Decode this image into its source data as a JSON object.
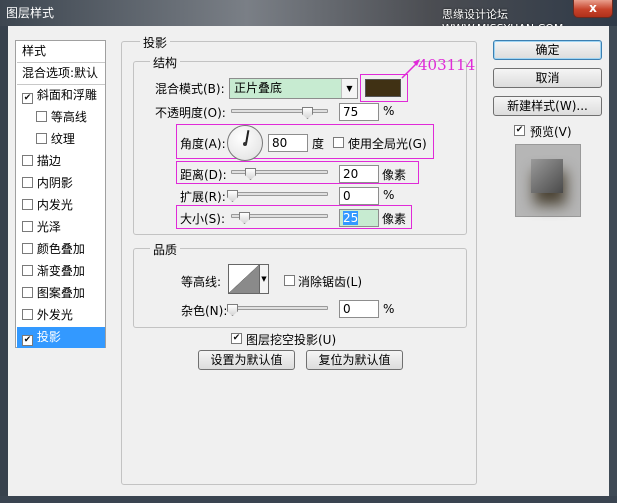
{
  "window": {
    "title": "图层样式",
    "watermark": "思缘设计论坛  WWW.MISSYUAN.COM",
    "close_label": "x"
  },
  "left_panel": {
    "items": [
      {
        "label": "样式",
        "checkbox": false,
        "checked": false,
        "selected": false
      },
      {
        "label": "混合选项:默认",
        "checkbox": false,
        "checked": false,
        "selected": false
      },
      {
        "label": "斜面和浮雕",
        "checkbox": true,
        "checked": true,
        "selected": false
      },
      {
        "label": "等高线",
        "checkbox": true,
        "checked": false,
        "selected": false
      },
      {
        "label": "纹理",
        "checkbox": true,
        "checked": false,
        "selected": false
      },
      {
        "label": "描边",
        "checkbox": true,
        "checked": false,
        "selected": false
      },
      {
        "label": "内阴影",
        "checkbox": true,
        "checked": false,
        "selected": false
      },
      {
        "label": "内发光",
        "checkbox": true,
        "checked": false,
        "selected": false
      },
      {
        "label": "光泽",
        "checkbox": true,
        "checked": false,
        "selected": false
      },
      {
        "label": "颜色叠加",
        "checkbox": true,
        "checked": false,
        "selected": false
      },
      {
        "label": "渐变叠加",
        "checkbox": true,
        "checked": false,
        "selected": false
      },
      {
        "label": "图案叠加",
        "checkbox": true,
        "checked": false,
        "selected": false
      },
      {
        "label": "外发光",
        "checkbox": true,
        "checked": false,
        "selected": false
      },
      {
        "label": "投影",
        "checkbox": true,
        "checked": true,
        "selected": true
      }
    ]
  },
  "drop_shadow": {
    "title": "投影",
    "structure": {
      "title": "结构",
      "blend_mode_label": "混合模式(B):",
      "blend_mode_value": "正片叠底",
      "shadow_color": "#403114",
      "color_annotation": "403114",
      "opacity_label": "不透明度(O):",
      "opacity_value": "75",
      "opacity_unit": "%",
      "angle_label": "角度(A):",
      "angle_value": "80",
      "angle_unit": "度",
      "global_light_label": "使用全局光(G)",
      "global_light_checked": false,
      "distance_label": "距离(D):",
      "distance_value": "20",
      "distance_unit": "像素",
      "spread_label": "扩展(R):",
      "spread_value": "0",
      "spread_unit": "%",
      "size_label": "大小(S):",
      "size_value": "25",
      "size_unit": "像素"
    },
    "quality": {
      "title": "品质",
      "contour_label": "等高线:",
      "antialias_label": "消除锯齿(L)",
      "antialias_checked": false,
      "noise_label": "杂色(N):",
      "noise_value": "0",
      "noise_unit": "%"
    },
    "knockout_label": "图层挖空投影(U)",
    "knockout_checked": true,
    "make_default_label": "设置为默认值",
    "reset_default_label": "复位为默认值"
  },
  "buttons": {
    "ok": "确定",
    "cancel": "取消",
    "new_style": "新建样式(W)...",
    "preview_label": "预览(V)",
    "preview_checked": true
  },
  "colors": {
    "highlight": "#e02ad8",
    "selected": "#3399ff",
    "blend_select": "#c7ebd1"
  }
}
